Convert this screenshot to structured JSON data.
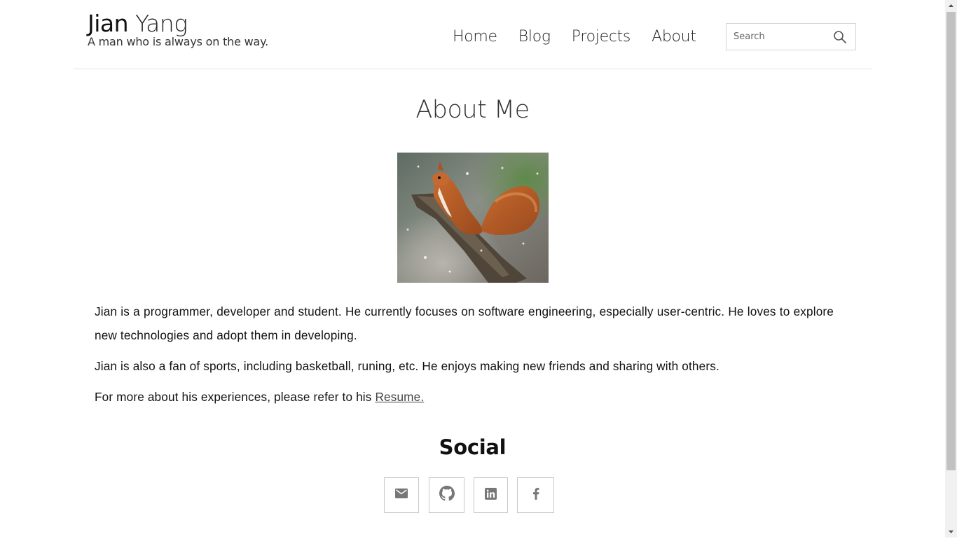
{
  "header": {
    "brand_first": "Jian",
    "brand_last": "Yang",
    "tagline": "A man who is always on the way.",
    "nav": [
      "Home",
      "Blog",
      "Projects",
      "About"
    ],
    "search_placeholder": "Search"
  },
  "main": {
    "title": "About Me",
    "photo_icon": "squirrel-photo",
    "paragraphs": [
      "Jian is a programmer, developer and student. He currently focuses on software engineering, especially user-centric. He loves to explore new technologies and adopt them in developing.",
      "Jian is also a fan of sports, including basketball, runing, etc. He enjoys making new friends and sharing with others."
    ],
    "resume_prefix": "For more about his experiences, please refer to his ",
    "resume_link": "Resume."
  },
  "social": {
    "title": "Social",
    "links": [
      "mail-icon",
      "github-icon",
      "linkedin-icon",
      "facebook-icon"
    ]
  },
  "colors": {
    "icon_gray": "#777777",
    "divider": "#e3e3e3"
  }
}
